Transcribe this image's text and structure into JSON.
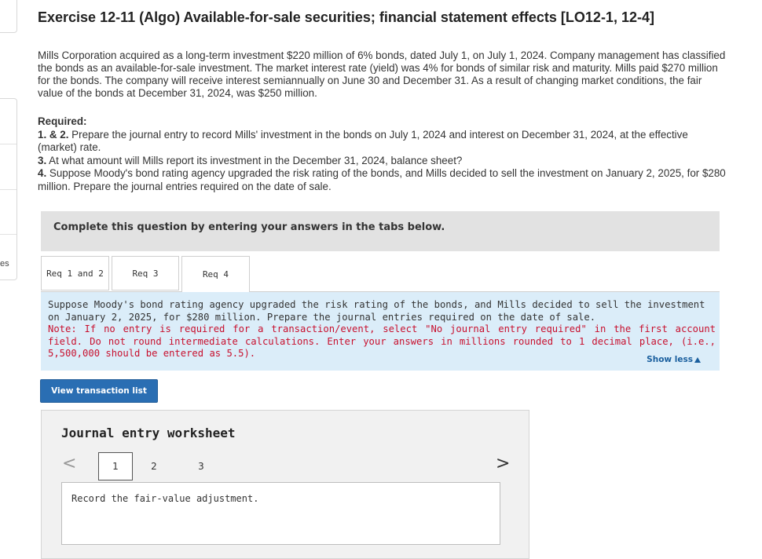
{
  "sidebar": {
    "cut_text": "es"
  },
  "exercise": {
    "title": "Exercise 12-11 (Algo) Available-for-sale securities; financial statement effects [LO12-1, 12-4]",
    "intro": "Mills Corporation acquired as a long-term investment $220 million of 6% bonds, dated July 1, on July 1, 2024. Company management has classified the bonds as an available-for-sale investment. The market interest rate (yield) was 4% for bonds of similar risk and maturity. Mills paid $270 million for the bonds. The company will receive interest semiannually on June 30 and December 31. As a result of changing market conditions, the fair value of the bonds at December 31, 2024, was $250 million.",
    "required_label": "Required:",
    "req1_num": "1. & 2.",
    "req1_text": " Prepare the journal entry to record Mills' investment in the bonds on July 1, 2024 and interest on December 31, 2024, at the effective (market) rate.",
    "req3_num": "3.",
    "req3_text": " At what amount will Mills report its investment in the December 31, 2024, balance sheet?",
    "req4_num": "4.",
    "req4_text": " Suppose Moody's bond rating agency upgraded the risk rating of the bonds, and Mills decided to sell the investment on January 2, 2025, for $280 million. Prepare the journal entries required on the date of sale."
  },
  "instructions": {
    "complete_text": "Complete this question by entering your answers in the tabs below."
  },
  "tabs": [
    {
      "label": "Req 1 and 2"
    },
    {
      "label": "Req 3"
    },
    {
      "label": "Req 4"
    }
  ],
  "active_tab": "Req 4",
  "panel": {
    "description": "Suppose Moody's bond rating agency upgraded the risk rating of the bonds, and Mills decided to sell the investment on January 2, 2025, for $280 million. Prepare the journal entries required on the date of sale.",
    "note": "Note: If no entry is required for a transaction/event, select \"No journal entry required\" in the first account field. Do not round intermediate calculations. Enter your answers in millions rounded to 1 decimal place, (i.e., 5,500,000 should be entered as 5.5).",
    "show_less": "Show less"
  },
  "buttons": {
    "view_transaction_list": "View transaction list"
  },
  "worksheet": {
    "title": "Journal entry worksheet",
    "pages": [
      "1",
      "2",
      "3"
    ],
    "current_page": "1",
    "prev_symbol": "<",
    "next_symbol": ">",
    "record_text": "Record the fair-value adjustment."
  },
  "colors": {
    "accent_blue": "#2a6eb3",
    "panel_bg": "#dbedf9",
    "note_red": "#c8102e",
    "link_blue": "#1a5f9e"
  }
}
